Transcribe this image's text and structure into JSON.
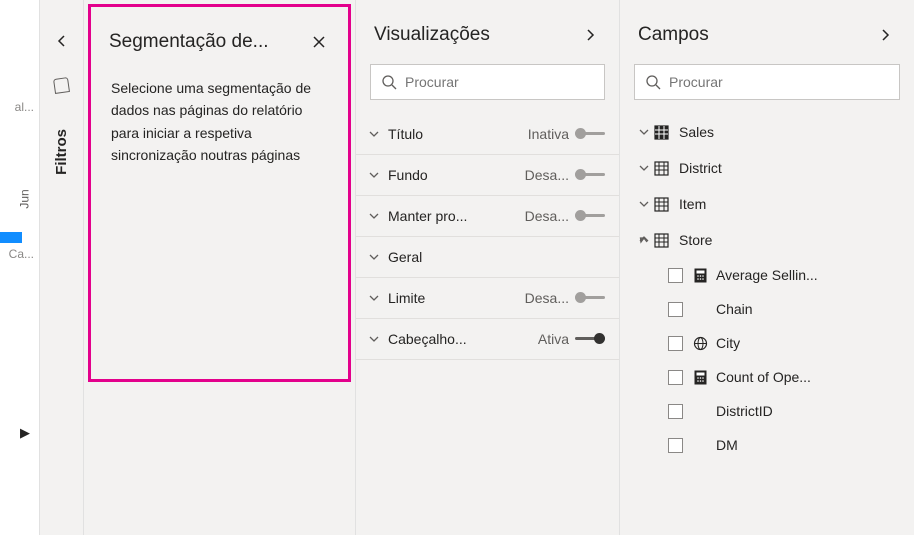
{
  "leftEdge": {
    "fragments": [
      "al...",
      "Jun",
      "Ca..."
    ]
  },
  "filtersRail": {
    "label": "Filtros"
  },
  "segPane": {
    "title": "Segmentação de...",
    "message": "Selecione uma segmentação de dados nas páginas do relatório para iniciar a respetiva sincronização noutras páginas"
  },
  "vizPane": {
    "title": "Visualizações",
    "searchPlaceholder": "Procurar",
    "properties": [
      {
        "label": "Título",
        "status": "Inativa",
        "on": false,
        "hasToggle": true
      },
      {
        "label": "Fundo",
        "status": "Desa...",
        "on": false,
        "hasToggle": true
      },
      {
        "label": "Manter pro...",
        "status": "Desa...",
        "on": false,
        "hasToggle": true
      },
      {
        "label": "Geral",
        "status": "",
        "on": false,
        "hasToggle": false
      },
      {
        "label": "Limite",
        "status": "Desa...",
        "on": false,
        "hasToggle": true
      },
      {
        "label": "Cabeçalho...",
        "status": "Ativa",
        "on": true,
        "hasToggle": true
      }
    ]
  },
  "fieldsPane": {
    "title": "Campos",
    "searchPlaceholder": "Procurar",
    "tables": [
      {
        "name": "Sales",
        "expanded": false,
        "iconFill": true
      },
      {
        "name": "District",
        "expanded": false,
        "iconFill": false
      },
      {
        "name": "Item",
        "expanded": false,
        "iconFill": false
      },
      {
        "name": "Store",
        "expanded": true,
        "iconFill": false
      }
    ],
    "storeFields": [
      {
        "name": "Average Sellin...",
        "icon": "calc"
      },
      {
        "name": "Chain",
        "icon": "none"
      },
      {
        "name": "City",
        "icon": "globe"
      },
      {
        "name": "Count of Ope...",
        "icon": "calc"
      },
      {
        "name": "DistrictID",
        "icon": "none"
      },
      {
        "name": "DM",
        "icon": "none"
      }
    ]
  }
}
